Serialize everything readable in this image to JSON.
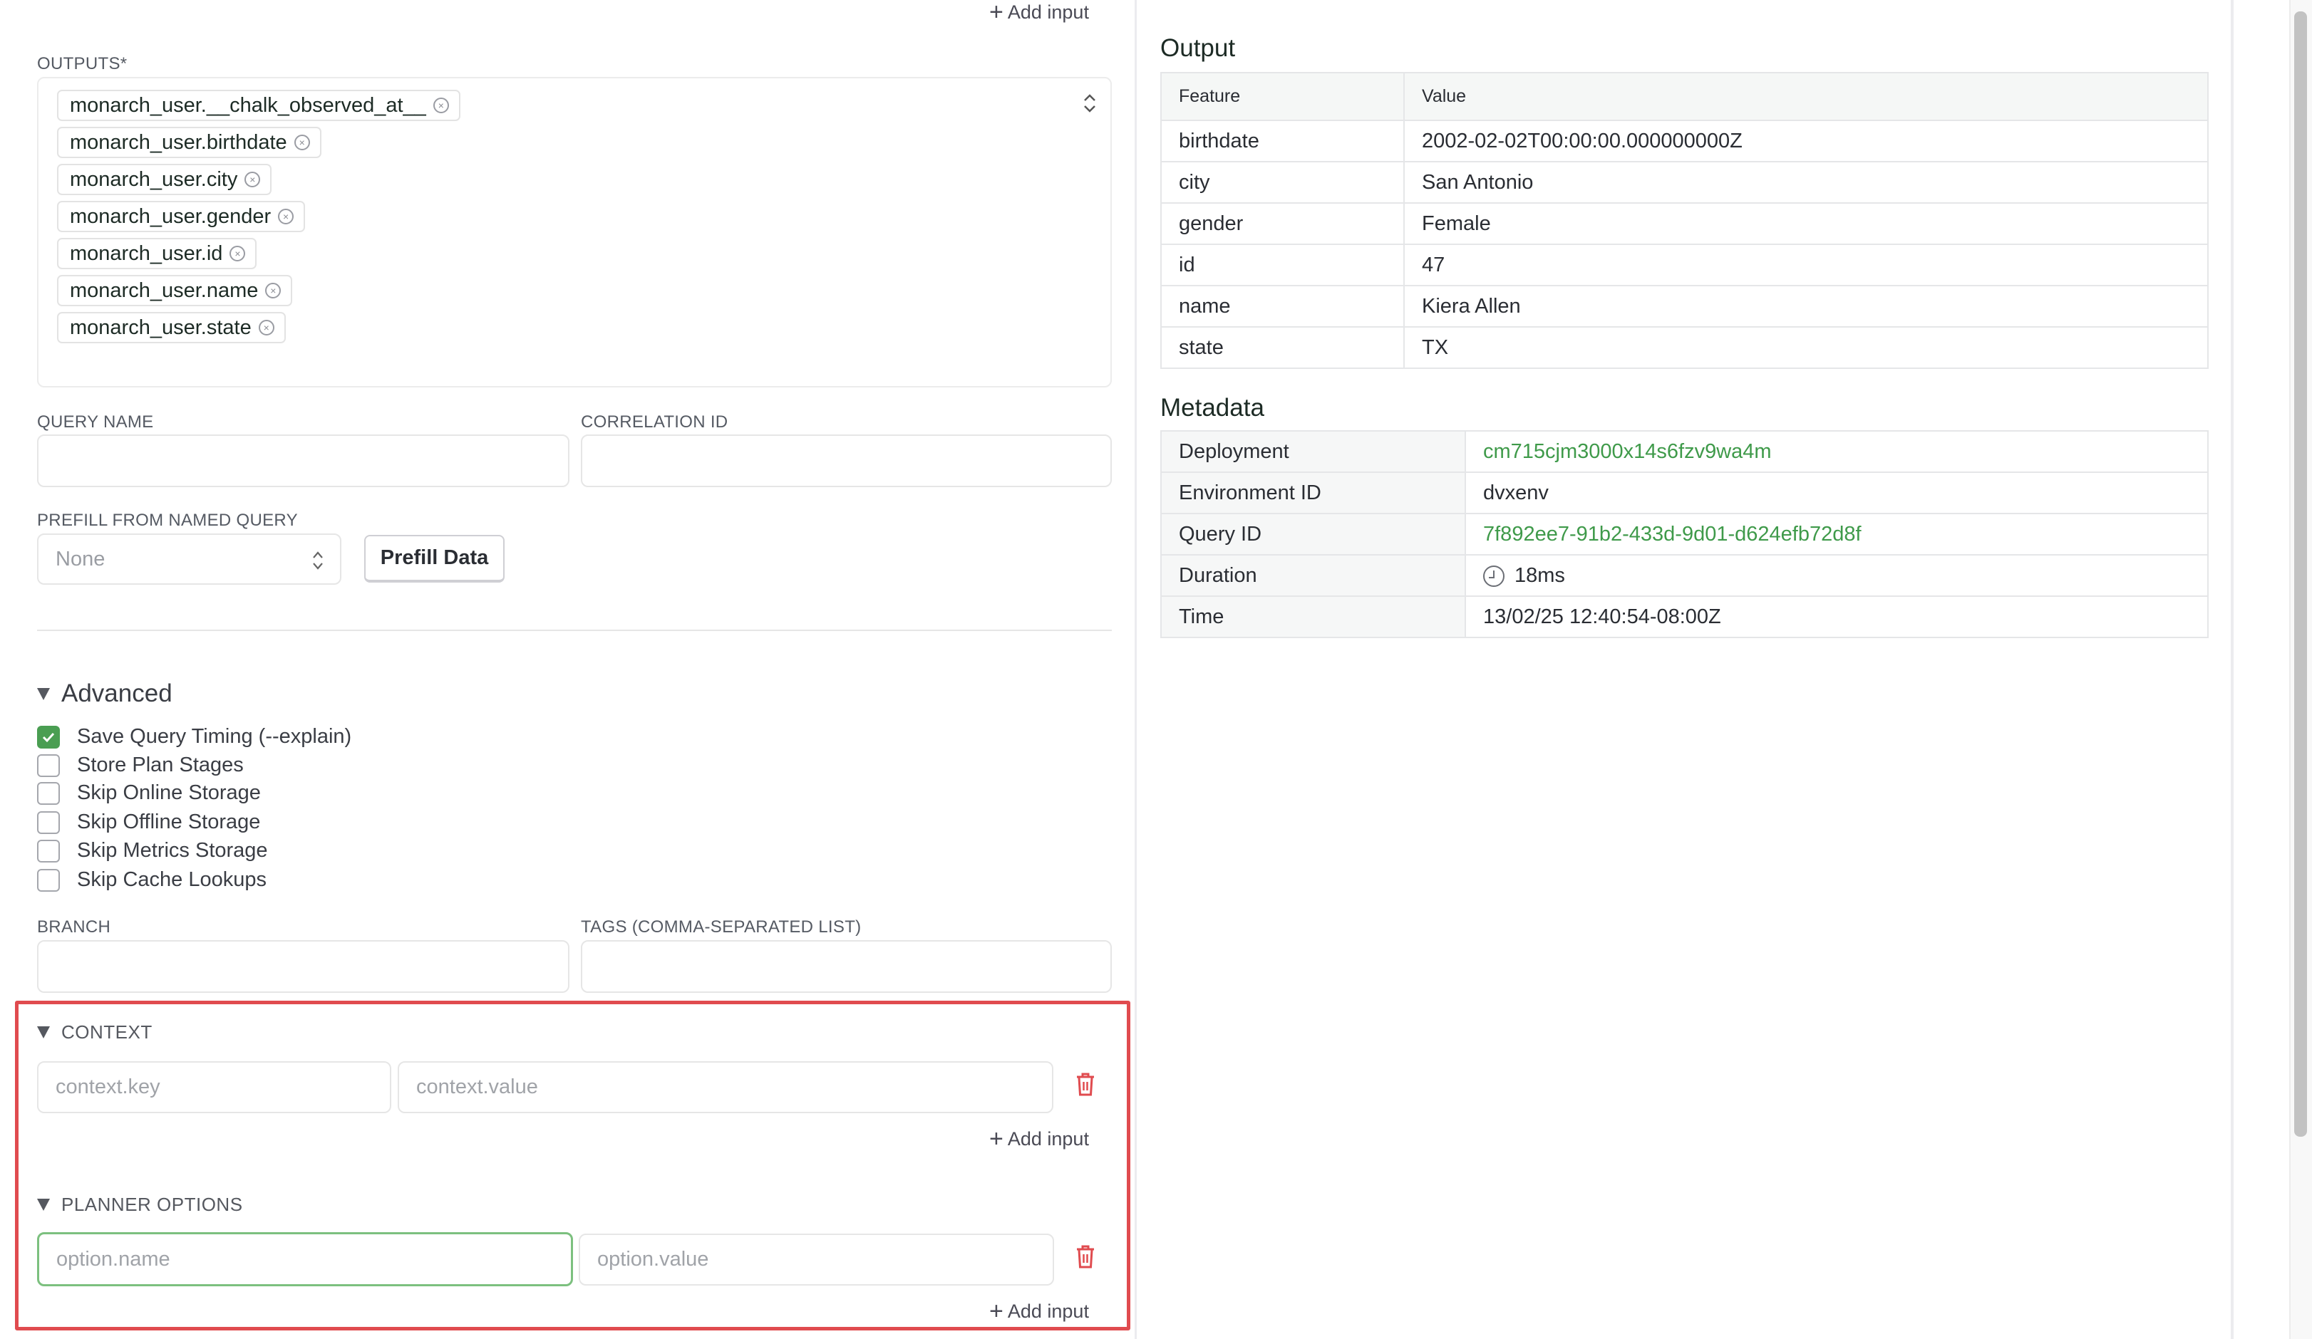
{
  "left": {
    "top_add_input": "Add input",
    "outputs": {
      "label": "OUTPUTS*",
      "chips": [
        "monarch_user.__chalk_observed_at__",
        "monarch_user.birthdate",
        "monarch_user.city",
        "monarch_user.gender",
        "monarch_user.id",
        "monarch_user.name",
        "monarch_user.state"
      ]
    },
    "query_name": {
      "label": "QUERY NAME",
      "value": "",
      "placeholder": ""
    },
    "correlation_id": {
      "label": "CORRELATION ID",
      "value": "",
      "placeholder": ""
    },
    "prefill": {
      "label": "PREFILL FROM NAMED QUERY",
      "selected": "None",
      "button": "Prefill Data"
    },
    "advanced": {
      "title": "Advanced",
      "options": [
        {
          "label": "Save Query Timing (--explain)",
          "checked": true
        },
        {
          "label": "Store Plan Stages",
          "checked": false
        },
        {
          "label": "Skip Online Storage",
          "checked": false
        },
        {
          "label": "Skip Offline Storage",
          "checked": false
        },
        {
          "label": "Skip Metrics Storage",
          "checked": false
        },
        {
          "label": "Skip Cache Lookups",
          "checked": false
        }
      ]
    },
    "branch": {
      "label": "BRANCH",
      "value": ""
    },
    "tags": {
      "label": "TAGS (COMMA-SEPARATED LIST)",
      "value": ""
    },
    "context": {
      "title": "CONTEXT",
      "key_placeholder": "context.key",
      "value_placeholder": "context.value",
      "add_input": "Add input"
    },
    "planner_options": {
      "title": "PLANNER OPTIONS",
      "name_placeholder": "option.name",
      "value_placeholder": "option.value",
      "add_input": "Add input"
    }
  },
  "output": {
    "title": "Output",
    "columns": [
      "Feature",
      "Value"
    ],
    "rows": [
      {
        "feature": "birthdate",
        "value": "2002-02-02T00:00:00.000000000Z"
      },
      {
        "feature": "city",
        "value": "San Antonio"
      },
      {
        "feature": "gender",
        "value": "Female"
      },
      {
        "feature": "id",
        "value": "47"
      },
      {
        "feature": "name",
        "value": "Kiera Allen"
      },
      {
        "feature": "state",
        "value": "TX"
      }
    ]
  },
  "metadata": {
    "title": "Metadata",
    "rows": [
      {
        "key": "Deployment",
        "value": "cm715cjm3000x14s6fzv9wa4m",
        "link": true
      },
      {
        "key": "Environment ID",
        "value": "dvxenv",
        "link": false
      },
      {
        "key": "Query ID",
        "value": "7f892ee7-91b2-433d-9d01-d624efb72d8f",
        "link": true
      },
      {
        "key": "Duration",
        "value": "18ms",
        "link": false,
        "icon": "clock-icon"
      },
      {
        "key": "Time",
        "value": "13/02/25 12:40:54-08:00Z",
        "link": false
      }
    ]
  },
  "colors": {
    "accent_green": "#3f9a4a",
    "checkbox_green": "#4a9e52",
    "highlight_red": "#e04b4f",
    "trash_red": "#e04b4f",
    "focus_green": "#7cc07f"
  }
}
